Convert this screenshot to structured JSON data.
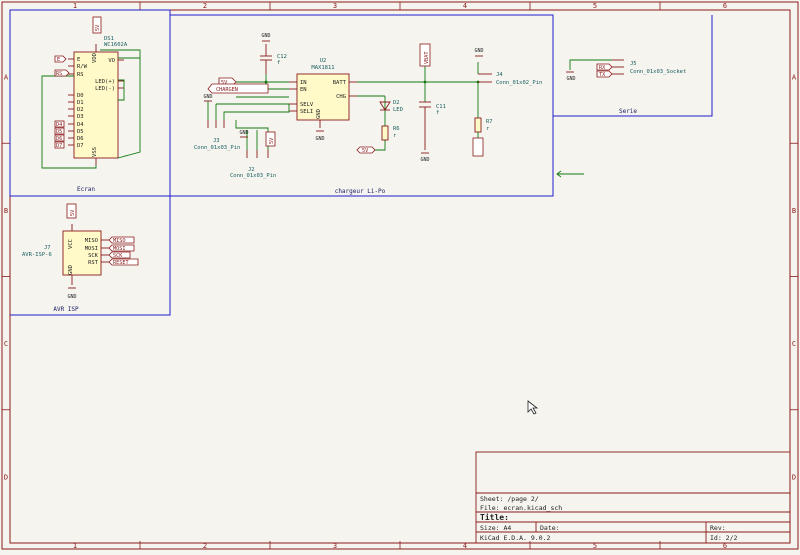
{
  "frame": {
    "cols_top": [
      "1",
      "2",
      "3",
      "4",
      "5",
      "6"
    ],
    "rows_left": [
      "A",
      "B",
      "C",
      "D"
    ]
  },
  "blocks": {
    "ecran": "Ecran",
    "chargeur": "chargeur Li-Po",
    "serie": "Serie",
    "avr_isp": "AVR ISP"
  },
  "components": {
    "ds1": {
      "ref": "DS1",
      "value": "WC1602A",
      "pins_left": [
        "E",
        "R/W",
        "RS",
        "D0",
        "D1",
        "D2",
        "D3",
        "D4",
        "D5",
        "D6",
        "D7"
      ],
      "pins_right": [
        "VO",
        "LED(+)",
        "LED(-)"
      ],
      "top": "VDD",
      "bottom": "VSS"
    },
    "u2": {
      "ref": "U2",
      "value": "MAX1811",
      "pins_left": [
        "IN",
        "EN",
        "SELV",
        "SELI"
      ],
      "pins_right": [
        "BATT",
        "CHG"
      ],
      "bottom": "GND"
    },
    "c12": {
      "ref": "C12",
      "value": "f"
    },
    "c11": {
      "ref": "C11",
      "value": "f"
    },
    "d2": {
      "ref": "D2",
      "value": "LED"
    },
    "r6": {
      "ref": "R6",
      "value": "r"
    },
    "r7": {
      "ref": "R7",
      "value": "r"
    },
    "j4": {
      "ref": "J4",
      "value": "Conn_01x02_Pin"
    },
    "j3": {
      "ref": "J3",
      "value": "Conn_01x03_Pin"
    },
    "j2": {
      "ref": "J2",
      "value": "Conn_01x03_Pin"
    },
    "j5": {
      "ref": "J5",
      "value": "Conn_01x03_Socket"
    },
    "j7": {
      "ref": "J7",
      "value": "AVR-ISP-6",
      "pins_right": [
        "MISO",
        "MOSI",
        "SCK",
        "RST"
      ],
      "top": "VCC",
      "bottom": "GND"
    }
  },
  "labels": {
    "v5": "5V",
    "gnd": "GND",
    "chargen": "CHARGEN",
    "vbat": "VBAT",
    "rx": "RX",
    "tx": "TX",
    "miso": "MISO",
    "mosi": "MOSI",
    "sck": "SCK",
    "reset": "RESET",
    "ds1_pins": [
      "D4",
      "D5",
      "D6",
      "D7"
    ],
    "ds1_e": "E",
    "ds1_rs": "RS"
  },
  "title_block": {
    "sheet": "Sheet: /page 2/",
    "file": "File: ecran.kicad_sch",
    "title": "Title:",
    "size": "Size: A4",
    "date": "Date:",
    "rev": "Rev:",
    "tool": "KiCad E.D.A. 9.0.2",
    "id": "Id: 2/2"
  },
  "colors": {
    "frame": "#8b1a1a",
    "hier_box": "#1e1ecc",
    "wire": "#127a12",
    "background": "#f5f4ef"
  }
}
